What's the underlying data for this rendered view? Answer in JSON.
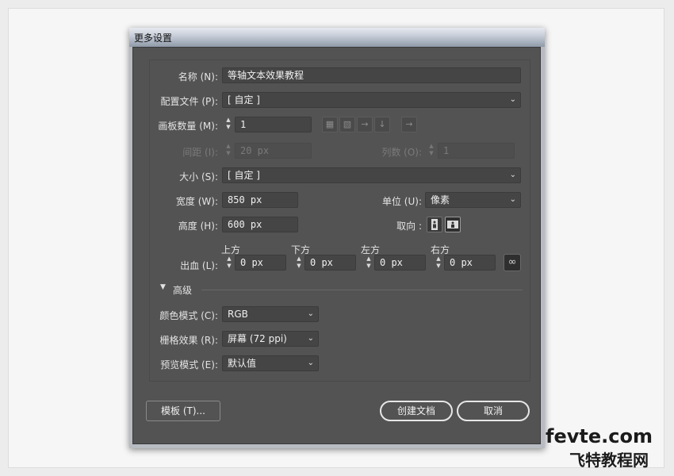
{
  "dialog": {
    "title": "更多设置"
  },
  "name": {
    "label": "名称 (N):",
    "value": "等轴文本效果教程"
  },
  "profile": {
    "label": "配置文件 (P):",
    "value": "[ 自定 ]"
  },
  "artboards": {
    "label": "画板数量 (M):",
    "value": "1"
  },
  "spacing": {
    "label": "间距 (I):",
    "value": "20 px"
  },
  "columns": {
    "label": "列数 (O):",
    "value": "1"
  },
  "size": {
    "label": "大小 (S):",
    "value": "[ 自定 ]"
  },
  "width": {
    "label": "宽度 (W):",
    "value": "850 px"
  },
  "units": {
    "label": "单位 (U):",
    "value": "像素"
  },
  "height": {
    "label": "高度 (H):",
    "value": "600 px"
  },
  "orientation": {
    "label": "取向 :",
    "selected": "landscape"
  },
  "bleed": {
    "label": "出血 (L):",
    "top": {
      "label": "上方",
      "value": "0 px"
    },
    "bottom": {
      "label": "下方",
      "value": "0 px"
    },
    "left": {
      "label": "左方",
      "value": "0 px"
    },
    "right": {
      "label": "右方",
      "value": "0 px"
    }
  },
  "advanced": {
    "label": "高级"
  },
  "color_mode": {
    "label": "颜色模式 (C):",
    "value": "RGB"
  },
  "raster": {
    "label": "栅格效果 (R):",
    "value": "屏幕 (72 ppi)"
  },
  "preview": {
    "label": "预览模式 (E):",
    "value": "默认值"
  },
  "buttons": {
    "templates": "模板 (T)...",
    "create": "创建文档",
    "cancel": "取消"
  },
  "watermark": {
    "line1": "fevte.com",
    "line2": "飞特教程网"
  },
  "colors": {
    "panel": "#535353",
    "titlebar": "#c9cfda",
    "field": "#454545"
  }
}
